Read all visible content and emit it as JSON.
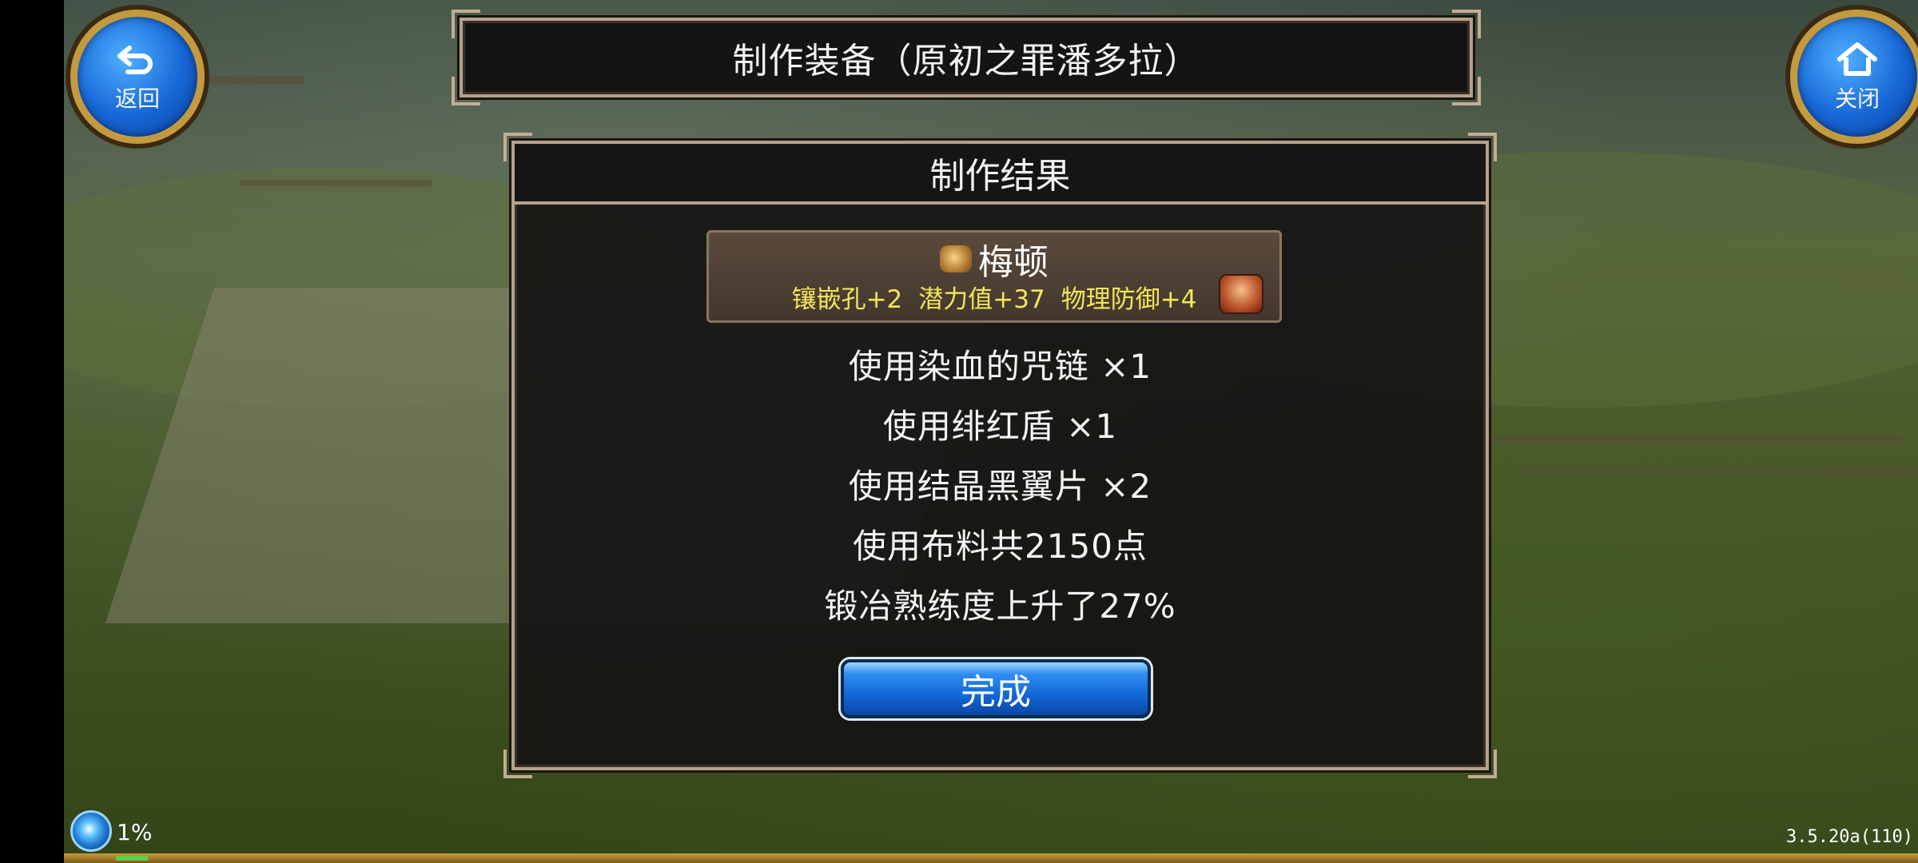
{
  "header": {
    "title": "制作装备（原初之罪潘多拉）"
  },
  "nav": {
    "back_label": "返回",
    "close_label": "关闭"
  },
  "panel": {
    "title": "制作结果",
    "item": {
      "name": "梅顿",
      "stats": [
        "镶嵌孔+2",
        "潜力值+37",
        "物理防御+4"
      ]
    },
    "lines": [
      "使用染血的咒链  ×1",
      "使用绯红盾  ×1",
      "使用结晶黑翼片  ×2",
      "使用布料共2150点",
      "锻冶熟练度上升了27%"
    ],
    "done_label": "完成"
  },
  "status": {
    "exp_text": "1%",
    "exp_progress": 0.01,
    "version": "3.5.20a(110)"
  },
  "colors": {
    "accent_blue": "#1167d8",
    "stat_yellow": "#f3e65a",
    "frame_tan": "#b4a28c"
  }
}
